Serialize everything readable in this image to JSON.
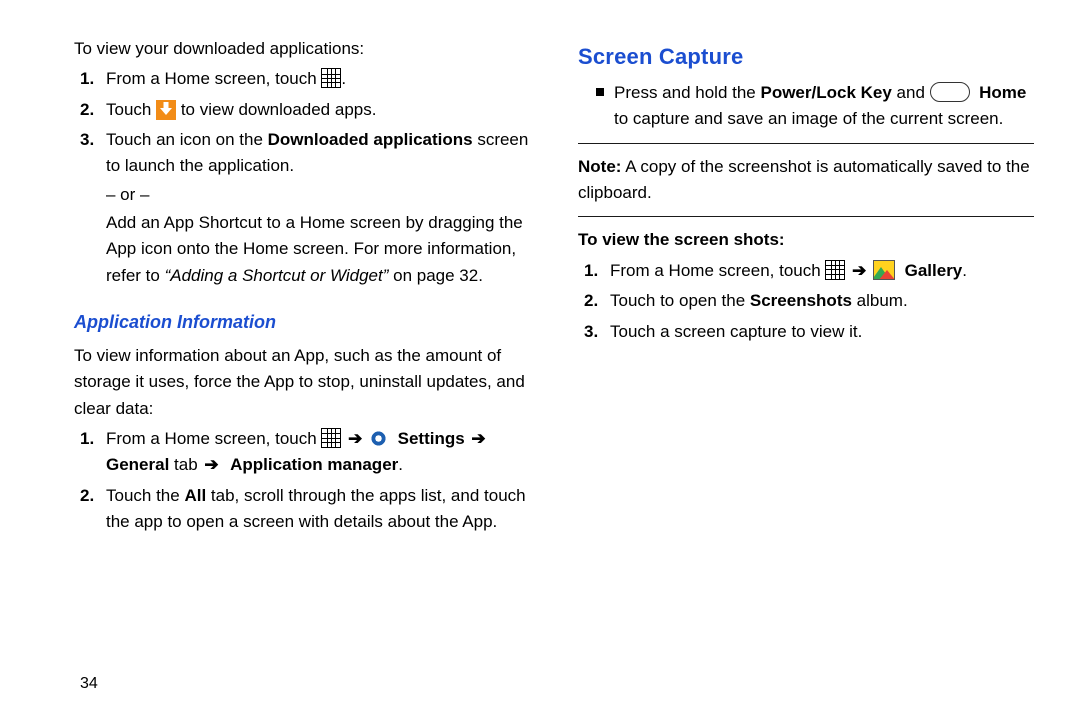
{
  "left": {
    "intro": "To view your downloaded applications:",
    "step1_a": "From a Home screen, touch ",
    "step1_b": ".",
    "step2_a": "Touch ",
    "step2_b": " to view downloaded apps.",
    "step3_a": "Touch an icon on the ",
    "step3_bold": "Downloaded applications",
    "step3_b": " screen to launch the application.",
    "or": "– or –",
    "step3_cont_a": "Add an App Shortcut to a Home screen by dragging the App icon onto the Home screen. For more information, refer to ",
    "step3_ref": "“Adding a Shortcut or Widget”",
    "step3_cont_b": " on page 32.",
    "subheading": "Application Information",
    "appinfo_intro": "To view information about an App, such as the amount of storage it uses, force the App to stop, uninstall updates, and clear data:",
    "ai_step1_a": "From a Home screen, touch ",
    "arrow": "➔",
    "ai_step1_settings": "Settings",
    "ai_step1_general": "General",
    "ai_step1_tab": " tab ",
    "ai_step1_appmgr": "Application manager",
    "ai_step2_a": "Touch the ",
    "ai_step2_all": "All",
    "ai_step2_b": " tab, scroll through the apps list, and touch the app to open a screen with details about the App."
  },
  "right": {
    "heading": "Screen Capture",
    "bullet_a": "Press and hold the ",
    "bullet_key": "Power/Lock Key",
    "bullet_and": " and ",
    "bullet_home": "Home",
    "bullet_b": " to capture and save an image of the current screen.",
    "note_lead": "Note:",
    "note_body": " A copy of the screenshot is automatically saved to the clipboard.",
    "view_head": "To view the screen shots:",
    "v1_a": "From a Home screen, touch ",
    "v1_gallery": "Gallery",
    "v2_a": "Touch to open the ",
    "v2_b": "Screenshots",
    "v2_c": " album.",
    "v3": "Touch a screen capture to view it."
  },
  "page_number": "34"
}
